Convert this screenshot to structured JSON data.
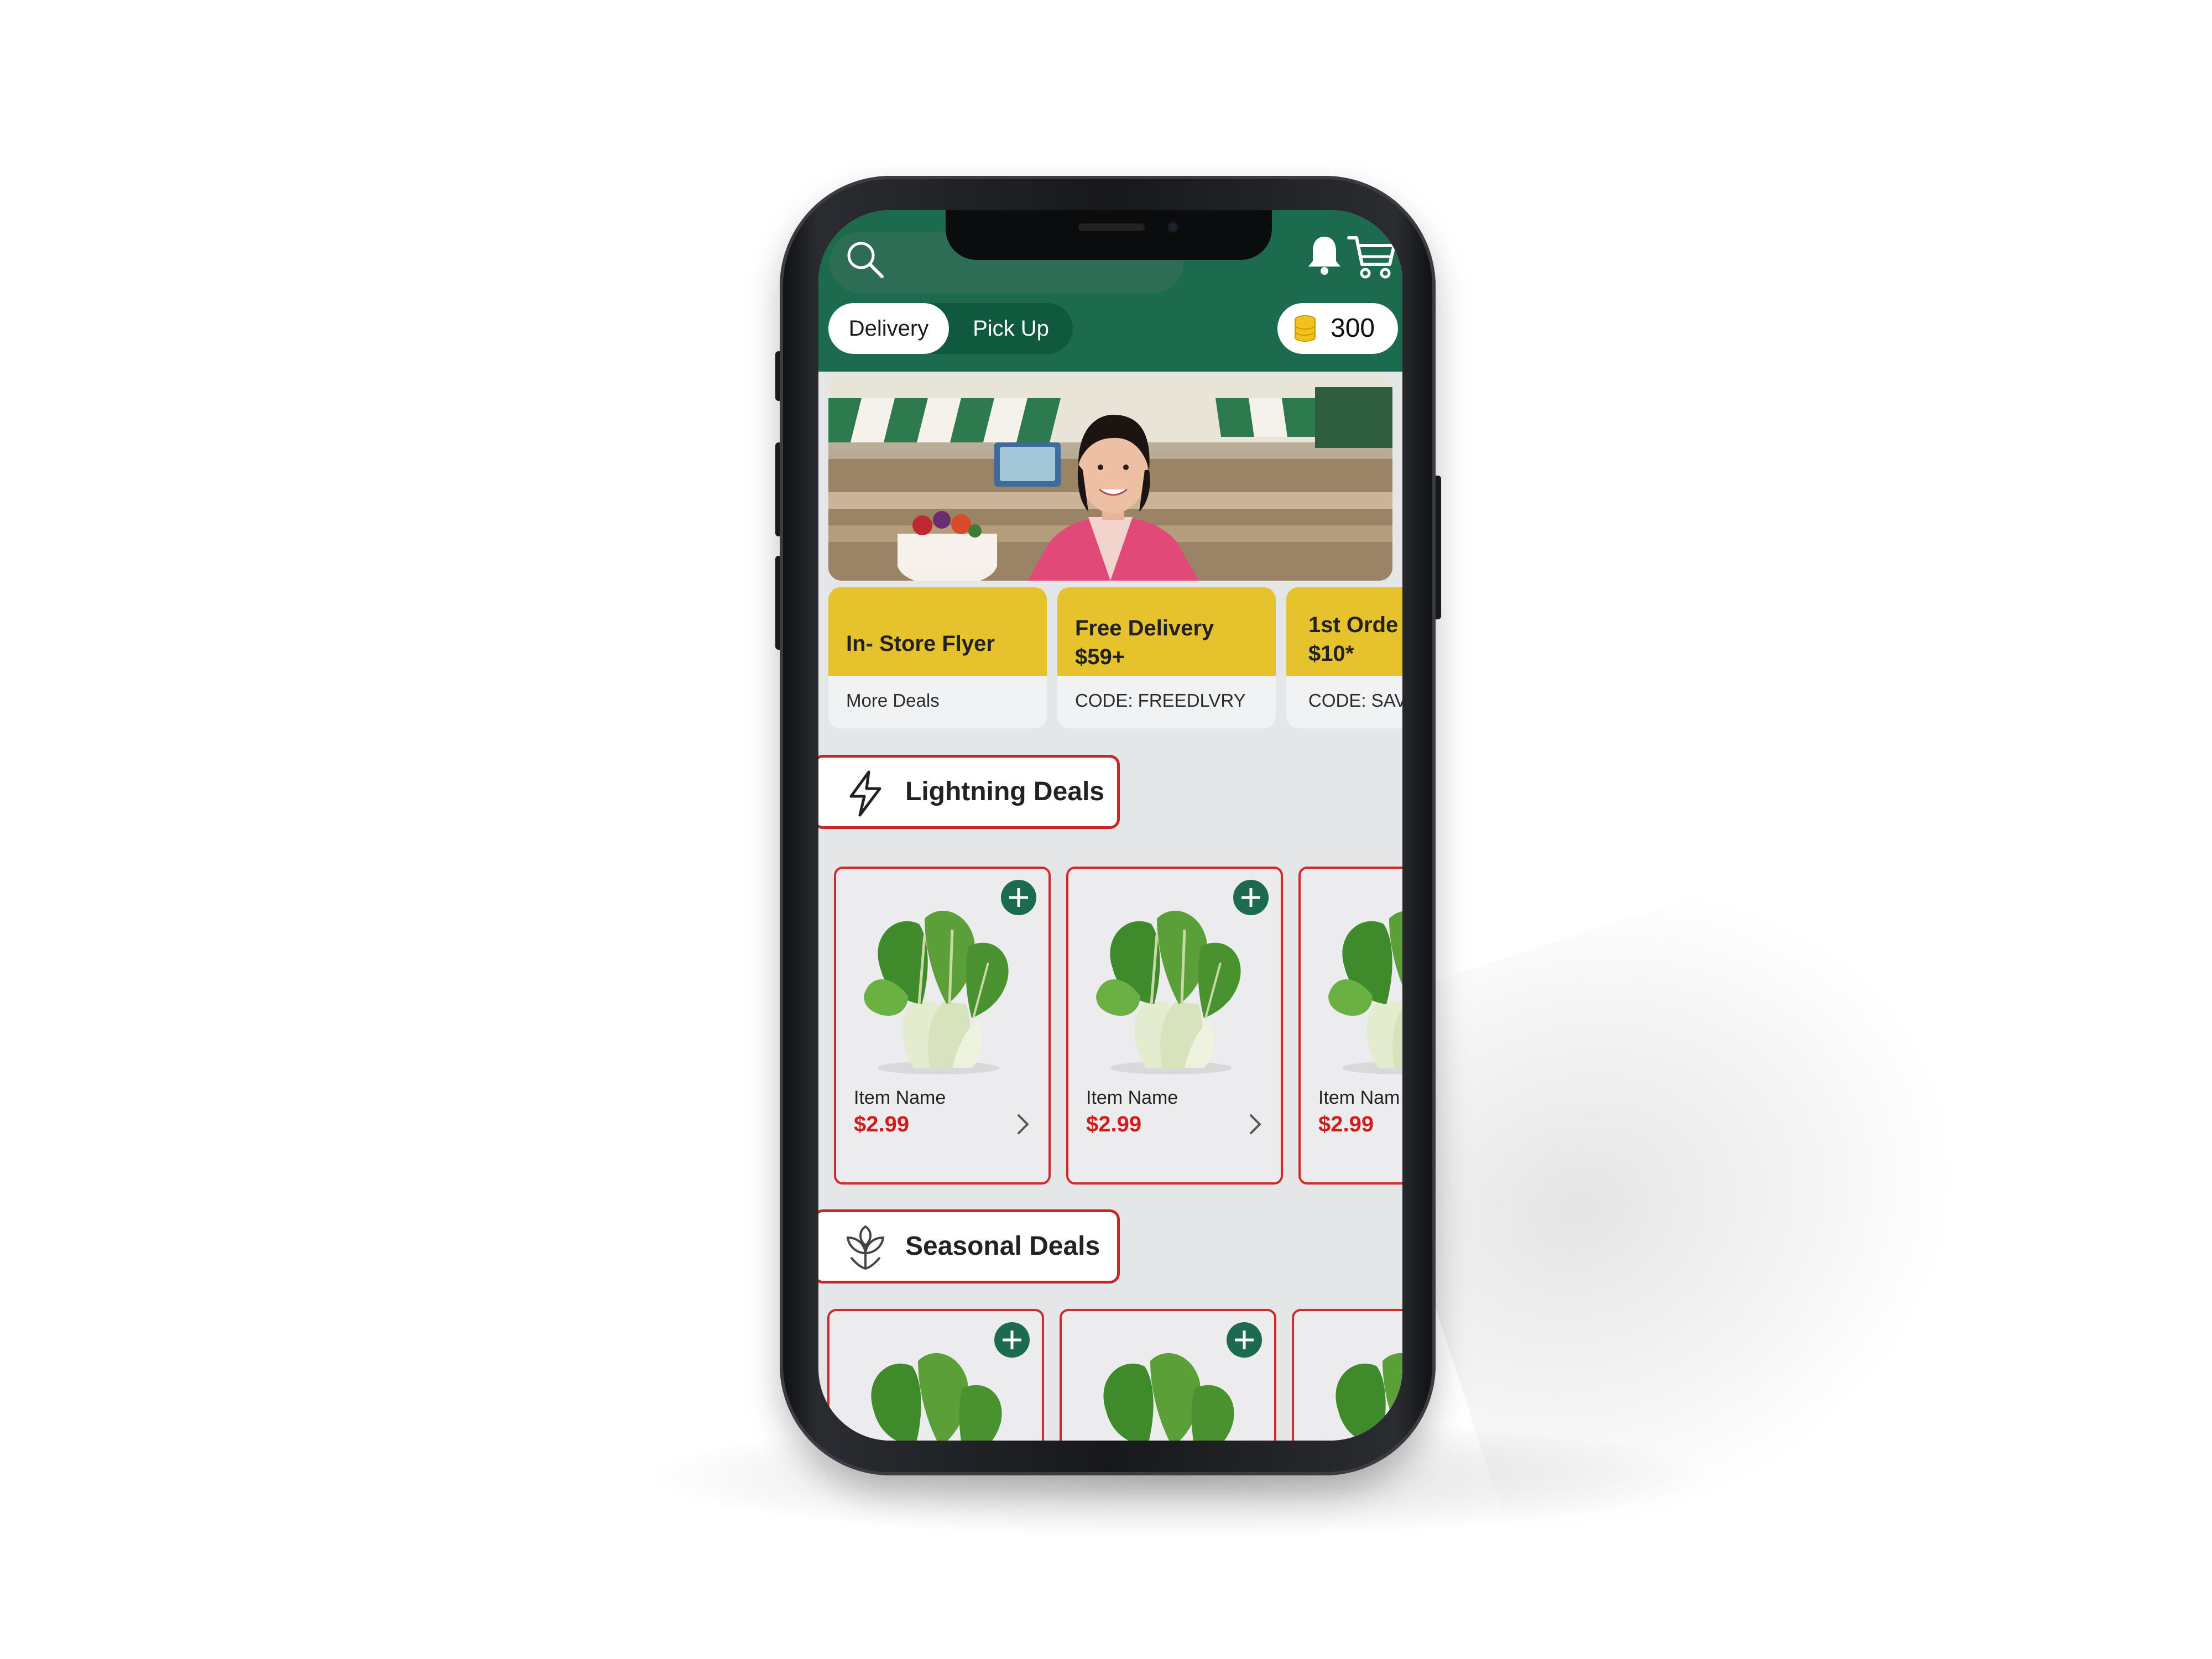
{
  "header": {
    "search_icon": "search-icon",
    "notification_icon": "bell-icon",
    "cart_icon": "cart-icon",
    "mode_options": [
      "Delivery",
      "Pick Up"
    ],
    "selected_mode": "Delivery",
    "points": "300",
    "points_icon": "coin-stack-icon"
  },
  "promos": [
    {
      "title": "In- Store Flyer",
      "line2": "",
      "subtitle": "More Deals"
    },
    {
      "title": "Free Delivery",
      "line2": "$59+",
      "subtitle": "CODE: FREEDLVRY"
    },
    {
      "title": "1st Orde",
      "line2": "$10*",
      "subtitle": "CODE: SAVE"
    }
  ],
  "sections": {
    "lightning": {
      "title": "Lightning Deals",
      "icon": "lightning-icon",
      "items": [
        {
          "name": "Item Name",
          "price": "$2.99"
        },
        {
          "name": "Item Name",
          "price": "$2.99"
        },
        {
          "name": "Item Nam",
          "price": "$2.99"
        }
      ]
    },
    "seasonal": {
      "title": "Seasonal Deals",
      "icon": "sprout-icon"
    }
  },
  "colors": {
    "brand_green": "#1c6b4e",
    "promo_yellow": "#e6c22c",
    "deal_red": "#d12a2a",
    "price_red": "#d11d1d"
  }
}
